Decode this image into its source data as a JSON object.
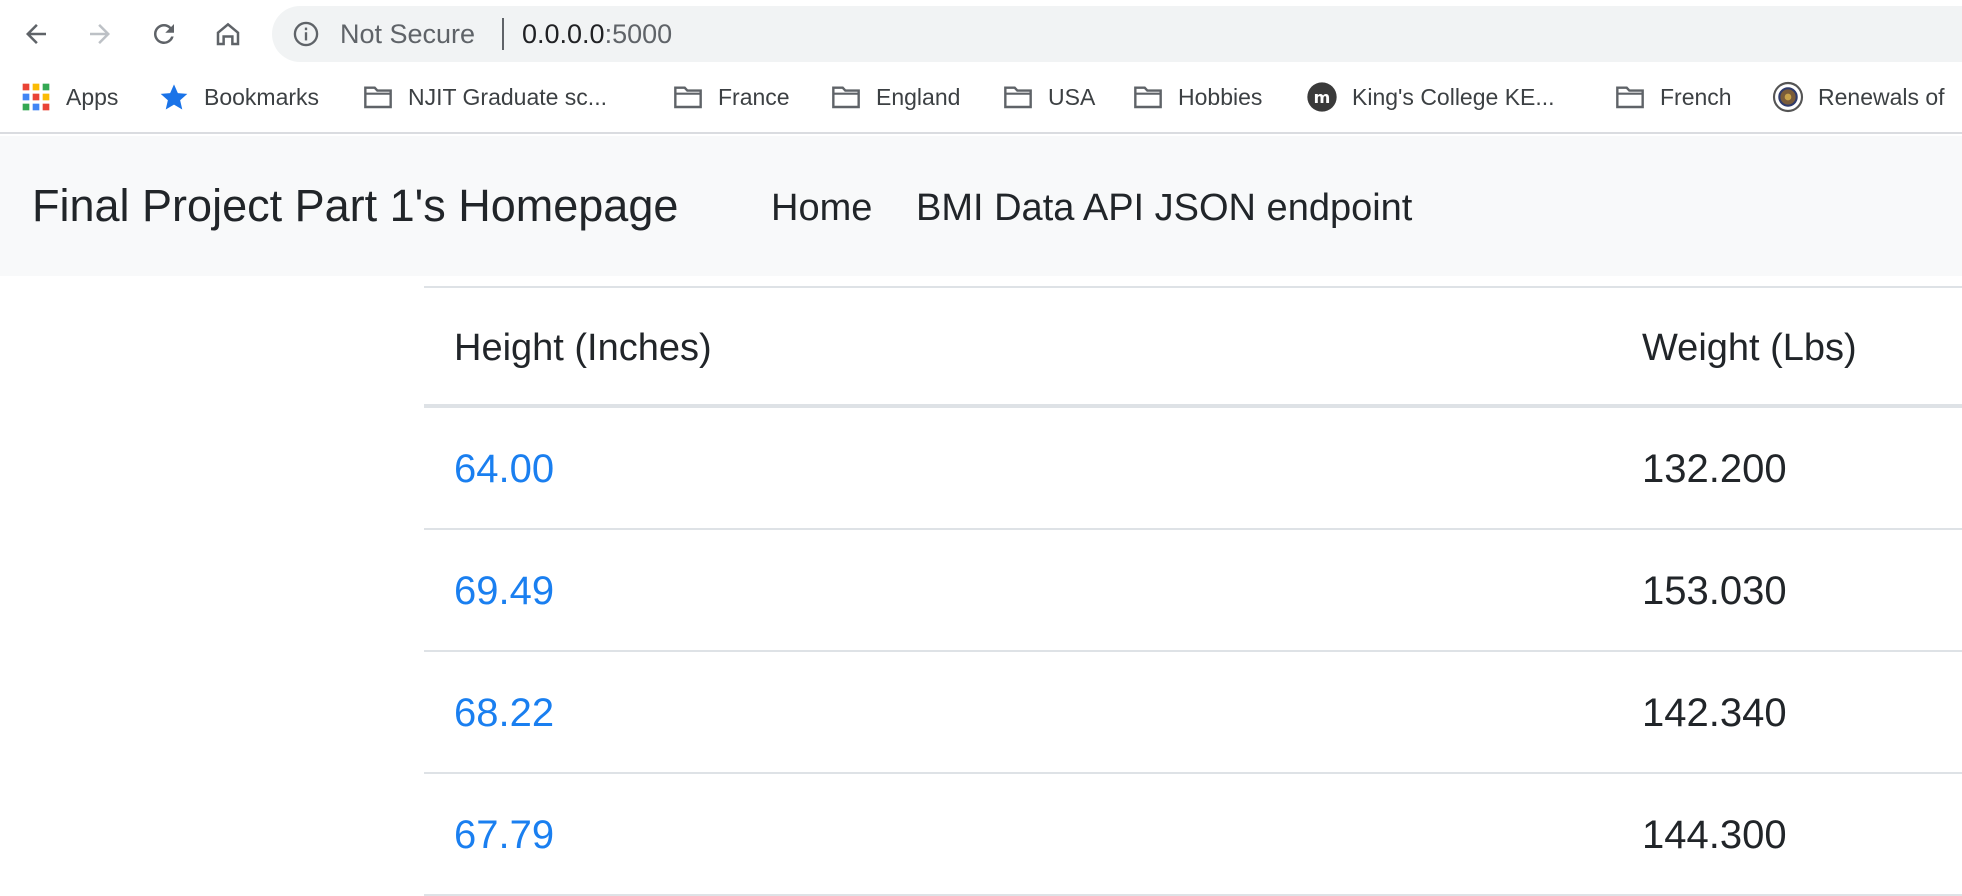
{
  "browser": {
    "security_label": "Not Secure",
    "url_host": "0.0.0.0",
    "url_port": ":5000"
  },
  "bookmarks": [
    {
      "label": "Apps",
      "icon": "apps-grid-icon"
    },
    {
      "label": "Bookmarks",
      "icon": "star-icon"
    },
    {
      "label": "NJIT Graduate sc...",
      "icon": "folder-icon"
    },
    {
      "label": "France",
      "icon": "folder-icon"
    },
    {
      "label": "England",
      "icon": "folder-icon"
    },
    {
      "label": "USA",
      "icon": "folder-icon"
    },
    {
      "label": "Hobbies",
      "icon": "folder-icon"
    },
    {
      "label": "King's College KE...",
      "icon": "moodle-icon"
    },
    {
      "label": "French",
      "icon": "folder-icon"
    },
    {
      "label": "Renewals of",
      "icon": "seal-icon"
    }
  ],
  "navbar": {
    "brand": "Final Project Part 1's Homepage",
    "links": [
      "Home",
      "BMI Data API JSON endpoint"
    ]
  },
  "table": {
    "headers": [
      "Height (Inches)",
      "Weight (Lbs)"
    ],
    "rows": [
      {
        "height": "64.00",
        "weight": "132.200"
      },
      {
        "height": "69.49",
        "weight": "153.030"
      },
      {
        "height": "68.22",
        "weight": "142.340"
      },
      {
        "height": "67.79",
        "weight": "144.300"
      }
    ]
  },
  "colors": {
    "link": "#1a7ff0",
    "navbar_bg": "#f8f9fa",
    "omnibox_bg": "#f1f3f4"
  }
}
